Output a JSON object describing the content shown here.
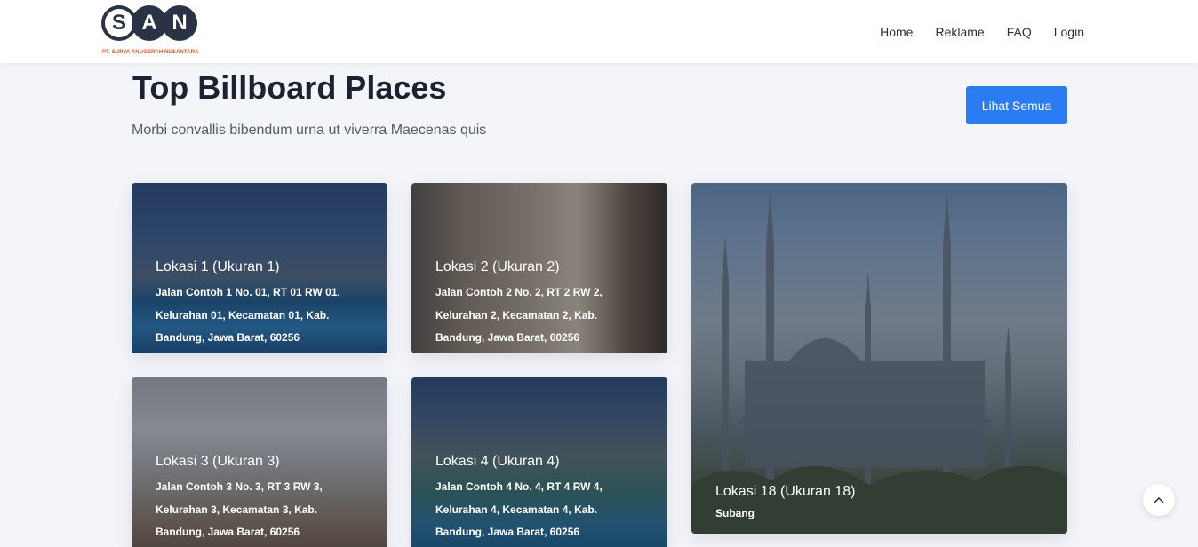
{
  "brand": {
    "logo_letters": [
      "S",
      "A",
      "N"
    ],
    "logo_subtitle": "PT. SURYA ANUGERAH NUSANTARA",
    "accent_color": "#e0561a",
    "dark_color": "#2a3246"
  },
  "nav": {
    "items": [
      {
        "label": "Home"
      },
      {
        "label": "Reklame"
      },
      {
        "label": "FAQ"
      },
      {
        "label": "Login"
      }
    ]
  },
  "section": {
    "title": "Top Billboard Places",
    "subtitle": "Morbi convallis bibendum urna ut viverra Maecenas quis",
    "see_all_label": "Lihat Semua",
    "button_color": "#2b7bf2"
  },
  "cards": [
    {
      "title": "Lokasi 1 (Ukuran 1)",
      "address": "Jalan Contoh 1 No. 01, RT 01 RW 01, Kelurahan 01, Kecamatan 01, Kab. Bandung, Jawa Barat, 60256",
      "address_lines": [
        "Jalan Contoh 1 No. 01, RT 01 RW 01,",
        "Kelurahan 01, Kecamatan 01, Kab.",
        "Bandung, Jawa Barat, 60256"
      ]
    },
    {
      "title": "Lokasi 2 (Ukuran 2)",
      "address_lines": [
        "Jalan Contoh 2 No. 2, RT 2 RW 2,",
        "Kelurahan 2, Kecamatan 2, Kab.",
        "Bandung, Jawa Barat, 60256"
      ]
    },
    {
      "title": "Lokasi 3 (Ukuran 3)",
      "address_lines": [
        "Jalan Contoh 3 No. 3, RT 3 RW 3,",
        "Kelurahan 3, Kecamatan 3, Kab.",
        "Bandung, Jawa Barat, 60256"
      ]
    },
    {
      "title": "Lokasi 4 (Ukuran 4)",
      "address_lines": [
        "Jalan Contoh 4 No. 4, RT 4 RW 4,",
        "Kelurahan 4, Kecamatan 4, Kab.",
        "Bandung, Jawa Barat, 60256"
      ]
    },
    {
      "title": "Lokasi 18 (Ukuran 18)",
      "address_lines": [
        "Subang"
      ]
    }
  ],
  "scroll_top": {
    "icon": "chevron-up-icon",
    "glyph": "︿"
  }
}
